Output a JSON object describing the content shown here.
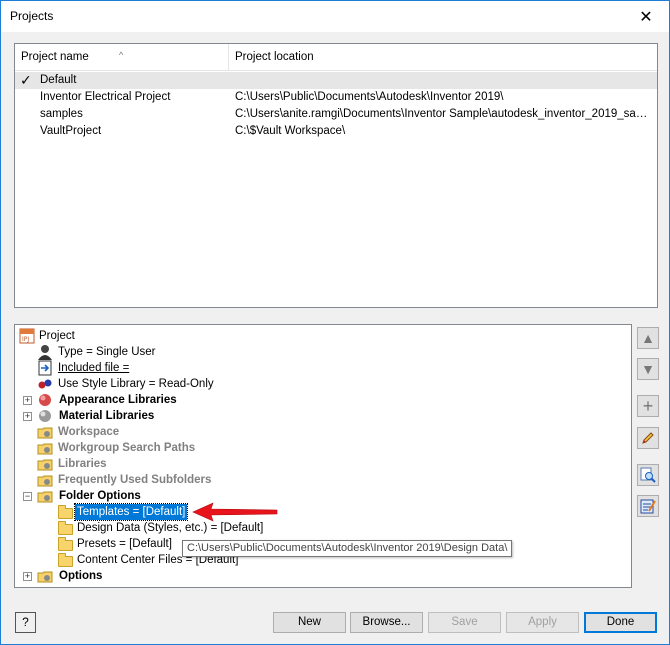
{
  "window": {
    "title": "Projects"
  },
  "project_list": {
    "columns": [
      "Project name",
      "Project location"
    ],
    "rows": [
      {
        "name": "Default",
        "location": "",
        "checked": true,
        "selected": true
      },
      {
        "name": "Inventor Electrical Project",
        "location": "C:\\Users\\Public\\Documents\\Autodesk\\Inventor 2019\\"
      },
      {
        "name": "samples",
        "location": "C:\\Users\\anite.ramgi\\Documents\\Inventor Sample\\autodesk_inventor_2019_sample..."
      },
      {
        "name": "VaultProject",
        "location": "C:\\$Vault Workspace\\"
      }
    ]
  },
  "tree": {
    "root": "Project",
    "type": "Type = Single User",
    "included_file": "Included file =",
    "use_style_library": "Use Style Library = Read-Only",
    "appearance_libraries": "Appearance Libraries",
    "material_libraries": "Material Libraries",
    "workspace": "Workspace",
    "workgroup_search_paths": "Workgroup Search Paths",
    "libraries": "Libraries",
    "frequently_used_subfolders": "Frequently Used Subfolders",
    "folder_options": "Folder Options",
    "templates": "Templates = [Default]",
    "design_data": "Design Data (Styles, etc.) = [Default]",
    "presets": "Presets = [Default]",
    "content_center_files": "Content Center Files = [Default]",
    "options": "Options"
  },
  "tooltip": "C:\\Users\\Public\\Documents\\Autodesk\\Inventor 2019\\Design Data\\",
  "buttons": {
    "help": "?",
    "new": "New",
    "browse": "Browse...",
    "save": "Save",
    "apply": "Apply",
    "done": "Done"
  },
  "colors": {
    "selection": "#0078d7",
    "arrow": "#e8141b",
    "border_accent": "#1e7dd6"
  }
}
